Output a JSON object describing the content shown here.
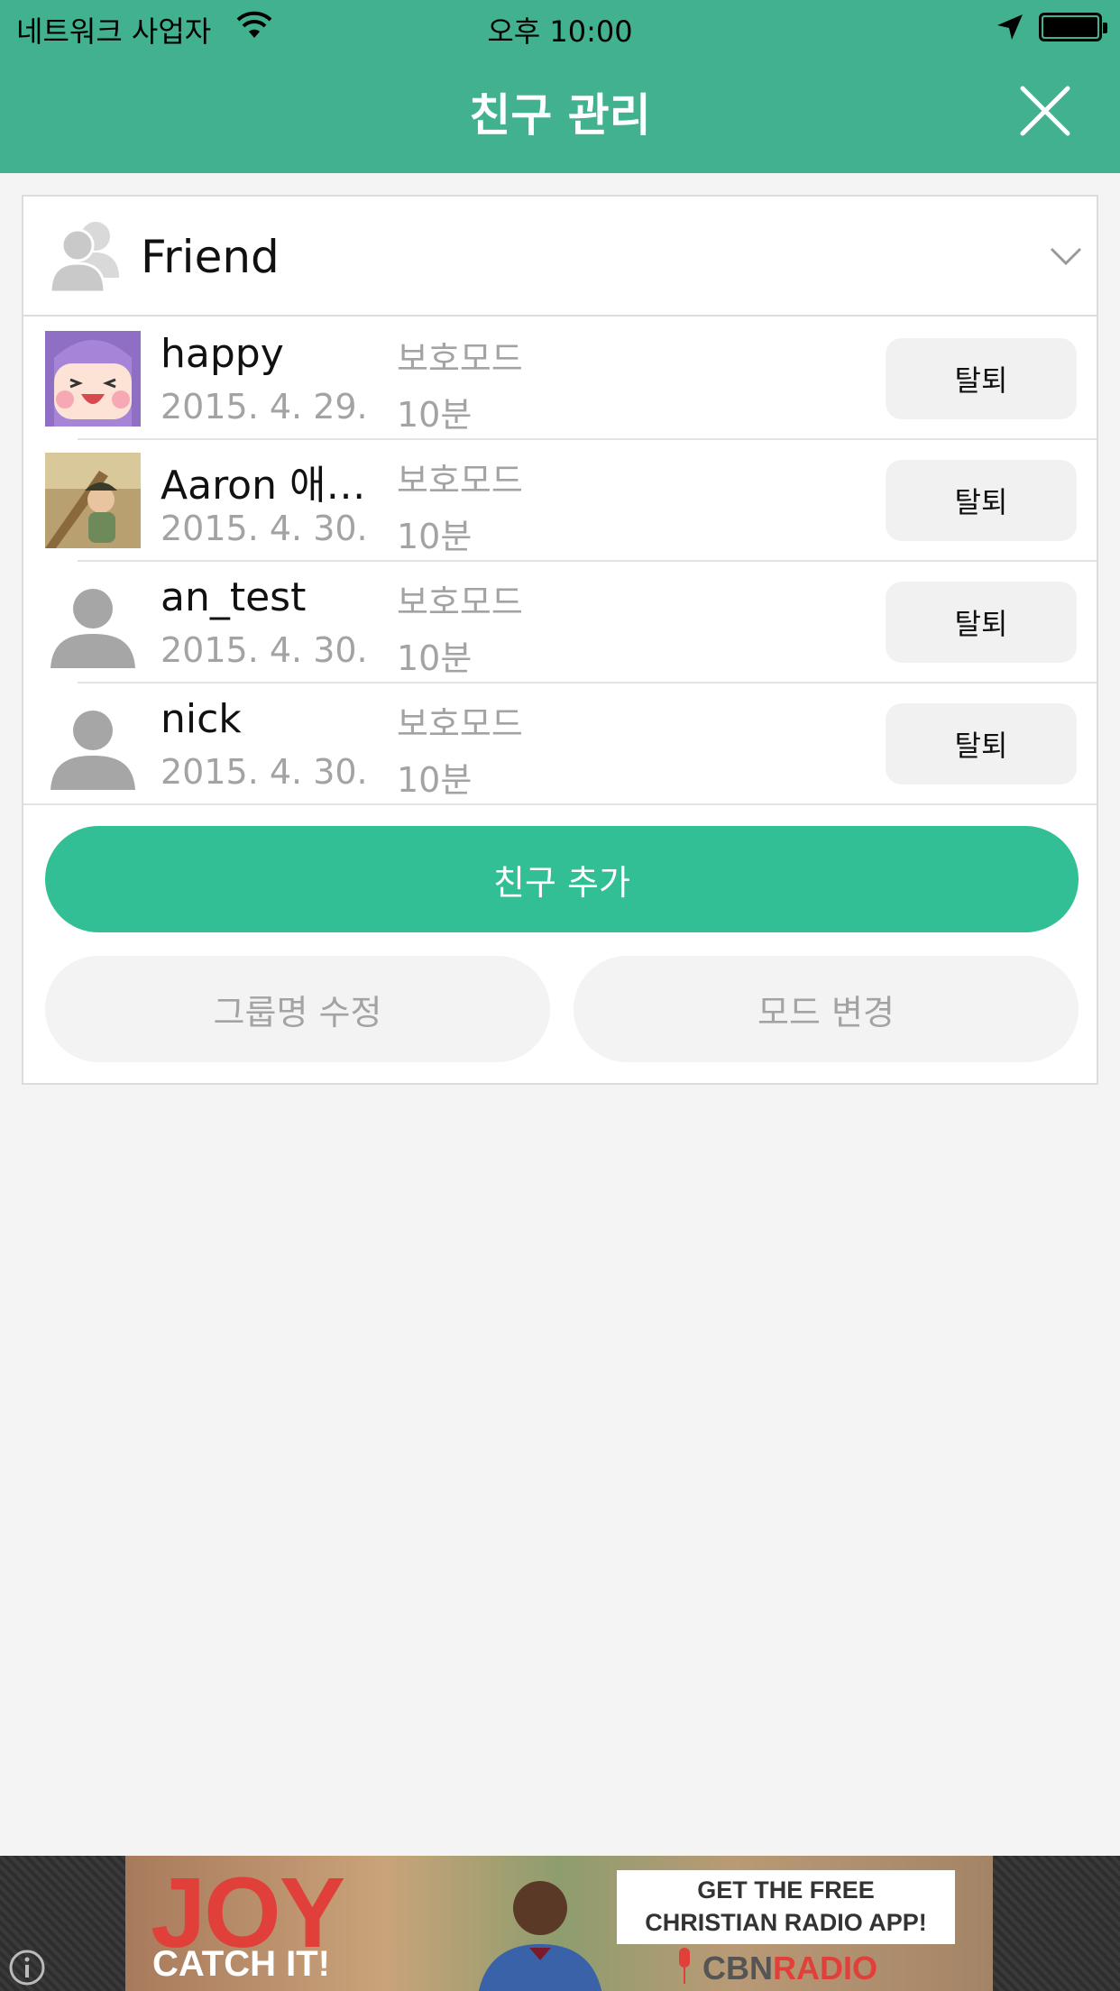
{
  "status_bar": {
    "carrier": "네트워크 사업자",
    "time": "오후 10:00"
  },
  "header": {
    "title": "친구 관리"
  },
  "group": {
    "name": "Friend"
  },
  "friends": [
    {
      "name": "happy",
      "date": "2015. 4. 29.",
      "mode": "보호모드",
      "duration": "10분",
      "action": "탈퇴"
    },
    {
      "name": "Aaron 애…",
      "date": "2015. 4. 30.",
      "mode": "보호모드",
      "duration": "10분",
      "action": "탈퇴"
    },
    {
      "name": "an_test",
      "date": "2015. 4. 30.",
      "mode": "보호모드",
      "duration": "10분",
      "action": "탈퇴"
    },
    {
      "name": "nick",
      "date": "2015. 4. 30.",
      "mode": "보호모드",
      "duration": "10분",
      "action": "탈퇴"
    }
  ],
  "actions": {
    "add_friend": "친구 추가",
    "rename_group": "그룹명 수정",
    "change_mode": "모드 변경"
  },
  "ad": {
    "brand": "JOY",
    "tagline": "CATCH IT!",
    "headline_line1": "GET THE FREE",
    "headline_line2": "CHRISTIAN RADIO APP!",
    "logo_prefix": "CBN",
    "logo_suffix": "RADIO"
  },
  "colors": {
    "header": "#41b190",
    "primary_button": "#33bf95",
    "background": "#f4f4f4"
  }
}
